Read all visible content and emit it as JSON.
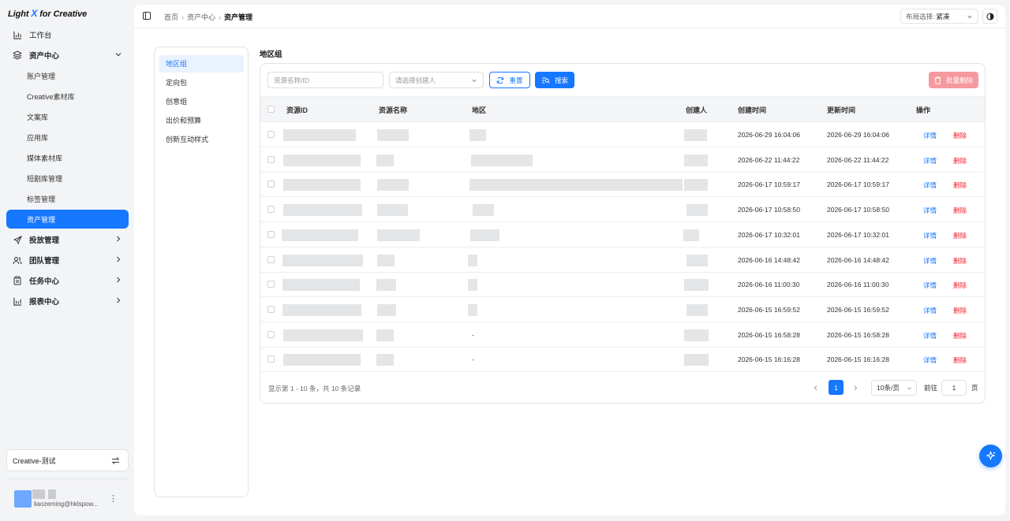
{
  "brand": {
    "part1": "Light ",
    "x": "X",
    "part2": " for Creative"
  },
  "sidebar": {
    "items": [
      {
        "label": "工作台",
        "icon": "bar-chart-icon"
      },
      {
        "label": "资产中心",
        "icon": "layers-icon",
        "expanded": true,
        "children": [
          "账户管理",
          "Creative素材库",
          "文案库",
          "应用库",
          "媒体素材库",
          "短剧库管理",
          "标签管理",
          "资产管理"
        ],
        "active_child": "资产管理"
      },
      {
        "label": "投放管理",
        "icon": "send-icon"
      },
      {
        "label": "团队管理",
        "icon": "users-icon"
      },
      {
        "label": "任务中心",
        "icon": "clipboard-icon"
      },
      {
        "label": "报表中心",
        "icon": "report-icon"
      }
    ],
    "workspace": "Creative-测试",
    "user_email": "liaozeming@hklspow..."
  },
  "breadcrumb": [
    "首页",
    "资产中心",
    "资产管理"
  ],
  "layout_select": {
    "label": "布局选择:",
    "value": "紧凑"
  },
  "tree": {
    "items": [
      "地区组",
      "定向包",
      "创意组",
      "出价和预算",
      "创新互动样式"
    ],
    "active": 0
  },
  "section_title": "地区组",
  "filters": {
    "id_placeholder": "资源名称/ID",
    "creator_placeholder": "请选择创建人",
    "reset_label": "重置",
    "search_label": "搜索",
    "bulk_delete_label": "批量删除"
  },
  "table": {
    "columns": [
      "资源ID",
      "资源名称",
      "地区",
      "创建人",
      "创建时间",
      "更新时间",
      "操作"
    ],
    "detail_label": "详情",
    "delete_label": "删除",
    "rows": [
      {
        "created": "2026-06-29 16:04:06",
        "updated": "2026-06-29 16:04:06",
        "region": ""
      },
      {
        "created": "2026-06-22 11:44:22",
        "updated": "2026-06-22 11:44:22",
        "region": ""
      },
      {
        "created": "2026-06-17 10:59:17",
        "updated": "2026-06-17 10:59:17",
        "region": ""
      },
      {
        "created": "2026-06-17 10:58:50",
        "updated": "2026-06-17 10:58:50",
        "region": ""
      },
      {
        "created": "2026-06-17 10:32:01",
        "updated": "2026-06-17 10:32:01",
        "region": ""
      },
      {
        "created": "2026-06-16 14:48:42",
        "updated": "2026-06-16 14:48:42",
        "region": ""
      },
      {
        "created": "2026-06-16 11:00:30",
        "updated": "2026-06-16 11:00:30",
        "region": ""
      },
      {
        "created": "2026-06-15 16:59:52",
        "updated": "2026-06-15 16:59:52",
        "region": ""
      },
      {
        "created": "2026-06-15 16:58:28",
        "updated": "2026-06-15 16:58:28",
        "region": "-"
      },
      {
        "created": "2026-06-15 16:16:28",
        "updated": "2026-06-15 16:16:28",
        "region": "-"
      }
    ]
  },
  "pagination": {
    "summary": "显示第 1 - 10 条，共 10 条记录",
    "current_page": "1",
    "page_size": "10条/页",
    "goto_label": "前往",
    "goto_value": "1",
    "page_unit": "页"
  },
  "colors": {
    "primary": "#1677ff",
    "danger": "#f5222d",
    "danger_soft": "#f5999e"
  }
}
